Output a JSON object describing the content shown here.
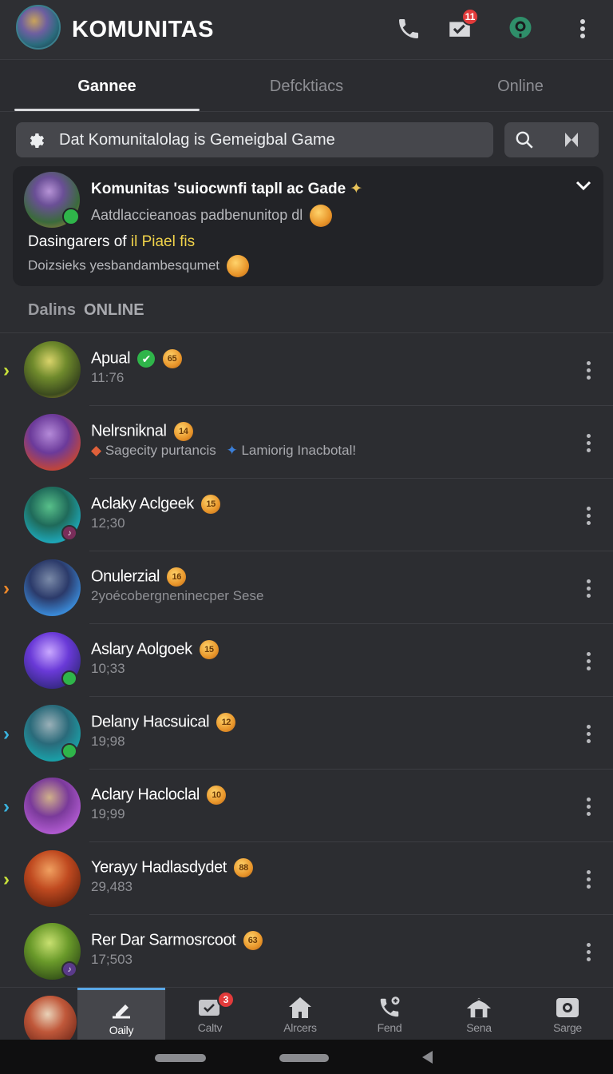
{
  "app": {
    "title": "KOMUNITAS",
    "inbox_badge": "11"
  },
  "tabs": [
    {
      "label": "Gannee",
      "active": true
    },
    {
      "label": "Defcktiacs",
      "active": false
    },
    {
      "label": "Online",
      "active": false
    }
  ],
  "search": {
    "value": "Dat Komunitalolag is Gemeigbal Game"
  },
  "featured": {
    "title": "Komunitas 'suiocwnfi tapll ac Gade",
    "subtitle": "Aatdlaccieanoas padbenunitop dl",
    "line2_prefix": "Dasingarers of ",
    "line2_highlight": "il Piael fis",
    "line3": "Doizsieks yesbandambesqumet"
  },
  "section": {
    "label": "Dalins",
    "online": "ONLINE"
  },
  "members": [
    {
      "name": "Apual",
      "badge": "65",
      "sub": "11:76",
      "verified": true,
      "arrow": "›",
      "arrow_color": "#c9e23a"
    },
    {
      "name": "Nelrsniknal",
      "badge": "14",
      "sub": "",
      "verified": false,
      "arrow": "",
      "arrow_color": "",
      "activity1": "Sagecity purtancis",
      "activity2": "Lamiorig Inacbotal!"
    },
    {
      "name": "Aclaky Aclgeek",
      "badge": "15",
      "sub": "12;30",
      "verified": false,
      "arrow": "",
      "arrow_color": ""
    },
    {
      "name": "Onulerzial",
      "badge": "16",
      "sub": "2yoécobergneninecper Sese",
      "verified": false,
      "arrow": "›",
      "arrow_color": "#f08a2a"
    },
    {
      "name": "Aslary Aolgoek",
      "badge": "15",
      "sub": "10;33",
      "verified": false,
      "arrow": "",
      "arrow_color": ""
    },
    {
      "name": "Delany Hacsuical",
      "badge": "12",
      "sub": "19;98",
      "verified": false,
      "arrow": "›",
      "arrow_color": "#3ab4e0"
    },
    {
      "name": "Aclary Hacloclal",
      "badge": "10",
      "sub": "19;99",
      "verified": false,
      "arrow": "›",
      "arrow_color": "#3ab4e0"
    },
    {
      "name": "Yerayy Hadlasdydet",
      "badge": "88",
      "sub": "29,483",
      "verified": false,
      "arrow": "›",
      "arrow_color": "#c9e23a"
    },
    {
      "name": "Rer Dar Sarmosrcoot",
      "badge": "63",
      "sub": "17;503",
      "verified": false,
      "arrow": "",
      "arrow_color": ""
    }
  ],
  "bottom_nav": [
    {
      "label": "Oaily",
      "icon": "pencil-icon",
      "active": true
    },
    {
      "label": "Caltv",
      "icon": "check-message-icon",
      "active": false,
      "badge": "3"
    },
    {
      "label": "Alrcers",
      "icon": "home-icon",
      "active": false
    },
    {
      "label": "Fend",
      "icon": "phone-add-icon",
      "active": false
    },
    {
      "label": "Sena",
      "icon": "store-icon",
      "active": false
    },
    {
      "label": "Sarge",
      "icon": "camera-icon",
      "active": false
    }
  ],
  "colors": {
    "background": "#2c2d31",
    "accent": "#5aa7e6",
    "badge_red": "#e23b3b",
    "online_green": "#2fb54a",
    "coin": "#e8952a"
  }
}
